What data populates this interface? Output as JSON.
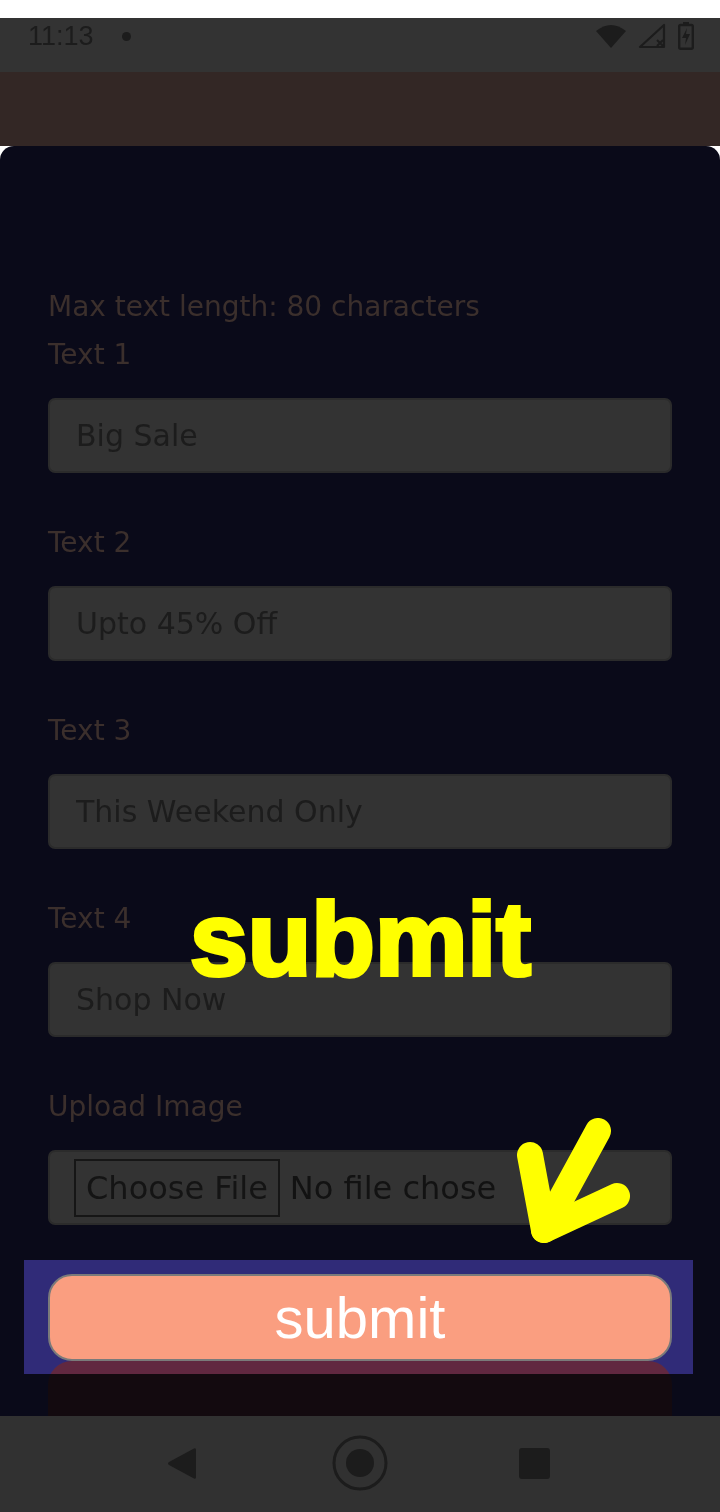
{
  "status_bar": {
    "time": "11:13"
  },
  "form": {
    "note": "Max text length: 80 characters",
    "fields": [
      {
        "kind": "text",
        "label": "Text 1",
        "value": "Big Sale"
      },
      {
        "kind": "text",
        "label": "Text 2",
        "value": "Upto 45% Off"
      },
      {
        "kind": "text",
        "label": "Text 3",
        "value": "This Weekend Only"
      },
      {
        "kind": "text",
        "label": "Text 4",
        "value": "Shop Now"
      },
      {
        "kind": "file",
        "label": "Upload Image",
        "button": "Choose File",
        "status": "No file chose"
      }
    ]
  },
  "submit_button": {
    "label": "submit"
  },
  "annotation": {
    "label": "submit"
  }
}
